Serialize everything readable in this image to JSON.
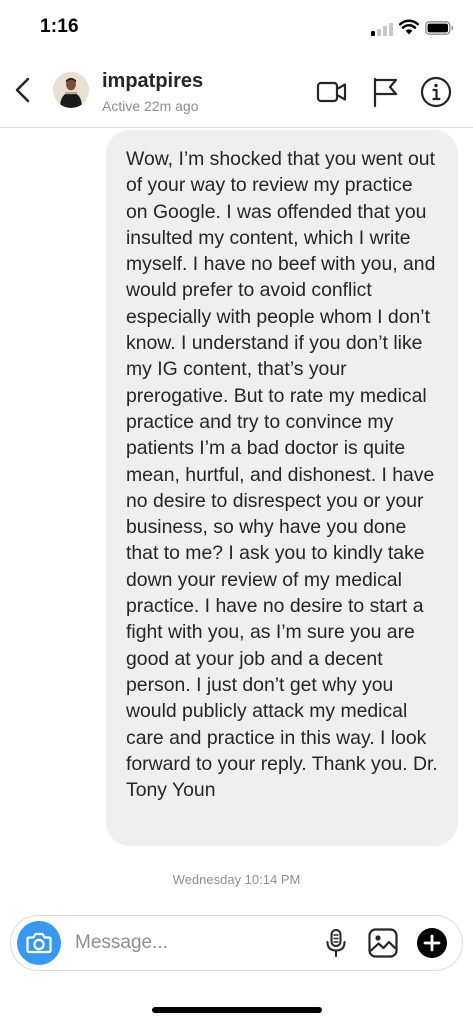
{
  "status_bar": {
    "time": "1:16",
    "signal_bars_active": 1,
    "signal_bars_total": 4,
    "wifi_icon": "wifi-icon",
    "battery_icon": "battery-icon"
  },
  "header": {
    "back_icon": "chevron-left-icon",
    "username": "impatpires",
    "presence": "Active 22m ago",
    "actions": [
      "video-camera-icon",
      "flag-icon",
      "info-icon"
    ]
  },
  "messages": [
    {
      "direction": "incoming",
      "text": "Wow, I’m shocked that you went out of your way to review my practice on Google. I was offended that you insulted my content, which I write myself. I have no beef with you, and would prefer to avoid conflict especially with people whom I don’t know. I understand if you don’t like my IG content, that’s your prerogative. But to rate my medical practice and try to convince my patients I’m a bad doctor is quite mean, hurtful, and dishonest. I have no desire to disrespect you or your business, so why have you done that to me? I ask you to kindly take down your review of my medical practice. I have no desire to start a fight with you, as I’m sure you are good at your job and a decent person. I just don’t get why you would publicly attack my medical care and practice in this way. I look forward to your reply. Thank you. Dr. Tony Youn"
    }
  ],
  "timestamp": "Wednesday 10:14 PM",
  "composer": {
    "placeholder": "Message...",
    "value": "",
    "icons": [
      "camera-icon",
      "microphone-icon",
      "gallery-icon",
      "plus-icon"
    ]
  },
  "colors": {
    "accent": "#3897f0",
    "bubble": "#efefef",
    "muted_text": "#8e8e8e",
    "divider": "#dbdbdb",
    "text": "#262626"
  }
}
